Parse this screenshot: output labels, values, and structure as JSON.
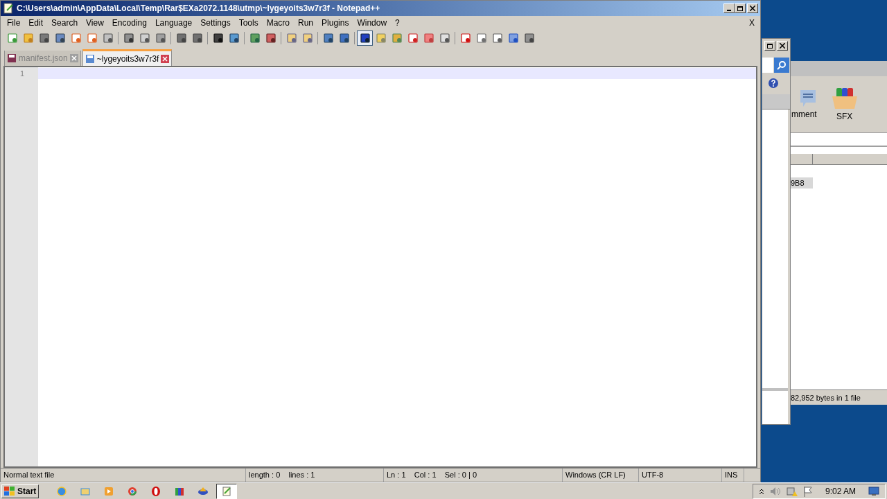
{
  "window": {
    "title": "C:\\Users\\admin\\AppData\\Local\\Temp\\Rar$EXa2072.1148\\utmp\\~lygeyoits3w7r3f - Notepad++"
  },
  "menu": [
    "File",
    "Edit",
    "Search",
    "View",
    "Encoding",
    "Language",
    "Settings",
    "Tools",
    "Macro",
    "Run",
    "Plugins",
    "Window",
    "?"
  ],
  "menu_close": "X",
  "toolbar": [
    {
      "selected": false
    },
    {
      "selected": false
    },
    {
      "selected": false
    },
    {
      "selected": false
    },
    {
      "selected": false
    },
    {
      "selected": false
    },
    {
      "selected": false
    },
    {
      "selected": false
    },
    {
      "selected": false
    },
    {
      "selected": false
    },
    {
      "selected": false
    },
    {
      "selected": false
    },
    {
      "selected": false
    },
    {
      "selected": false
    },
    {
      "selected": false
    },
    {
      "selected": false
    },
    {
      "selected": false
    },
    {
      "selected": false
    },
    {
      "selected": false
    },
    {
      "selected": false
    },
    {
      "selected": true
    },
    {
      "selected": false
    },
    {
      "selected": false
    },
    {
      "selected": false
    },
    {
      "selected": false
    },
    {
      "selected": false
    },
    {
      "selected": false
    },
    {
      "selected": false
    },
    {
      "selected": false
    },
    {
      "selected": false
    },
    {
      "selected": false
    }
  ],
  "tabs": [
    {
      "label": "manifest.json",
      "selected": false
    },
    {
      "label": "~lygeyoits3w7r3f",
      "selected": true
    }
  ],
  "editor": {
    "line_numbers": [
      "1"
    ]
  },
  "status_bar": [
    "Normal text file",
    "length : 0    lines : 1",
    "Ln : 1    Col : 1    Sel : 0 | 0",
    "Windows (CR LF)",
    "UTF-8",
    "INS"
  ],
  "background_window": {
    "toolbar": [
      "mment",
      "SFX"
    ],
    "row": "9B8",
    "status": "82,952 bytes in 1 file"
  },
  "taskbar": {
    "start": "Start",
    "apps": [
      {
        "selected": false
      },
      {
        "selected": false
      },
      {
        "selected": false
      },
      {
        "selected": false
      },
      {
        "selected": false
      },
      {
        "selected": false
      },
      {
        "selected": false
      },
      {
        "selected": true
      }
    ],
    "clock": "9:02 AM"
  }
}
